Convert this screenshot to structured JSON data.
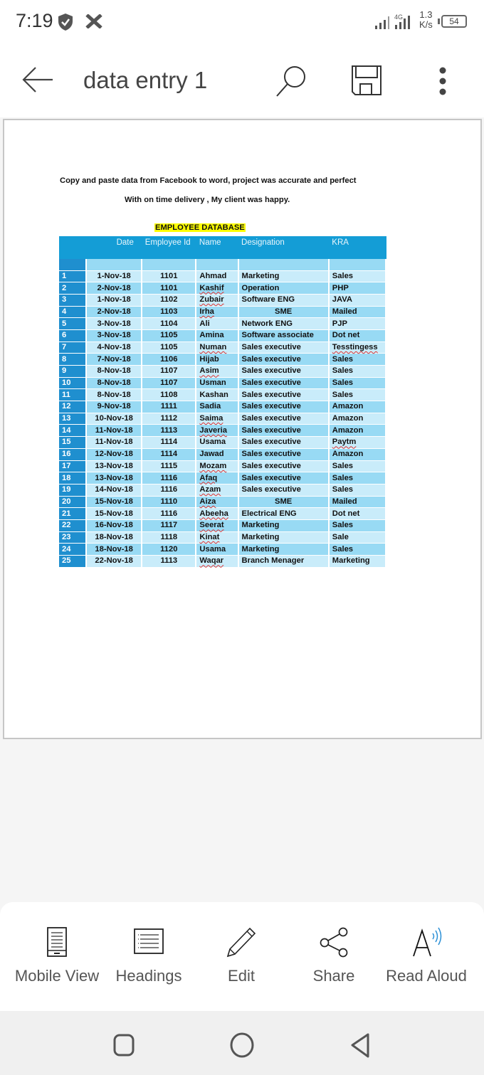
{
  "status_bar": {
    "time": "7:19",
    "network_type": "4G",
    "net_speed_value": "1.3",
    "net_speed_unit": "K/s",
    "battery": "54",
    "icons": [
      "shield-check-icon",
      "x-app-icon",
      "signal-icon",
      "signal-4g-icon",
      "battery-icon"
    ]
  },
  "toolbar": {
    "title": "data entry 1",
    "icons": [
      "back-arrow-icon",
      "search-icon",
      "save-icon",
      "more-vert-icon"
    ]
  },
  "document": {
    "line1": "Copy and paste data from Facebook to word, project was accurate and perfect",
    "line2": "With on time delivery , My client was happy.",
    "heading": "EMPLOYEE DATABASE",
    "heading_highlight": "#ffff00",
    "table": {
      "headers": [
        "",
        "Date",
        "Employee Id",
        "Name",
        "Designation",
        "KRA"
      ],
      "header_color": "#149dd6",
      "rows": [
        {
          "no": "1",
          "date": "1-Nov-18",
          "id": "1101",
          "name": "Ahmad",
          "designation": "Marketing",
          "kra": "Sales"
        },
        {
          "no": "2",
          "date": "2-Nov-18",
          "id": "1101",
          "name": "Kashif",
          "designation": "Operation",
          "kra": "PHP"
        },
        {
          "no": "3",
          "date": "1-Nov-18",
          "id": "1102",
          "name": "Zubair",
          "designation": "Software ENG",
          "kra": "JAVA"
        },
        {
          "no": "4",
          "date": "2-Nov-18",
          "id": "1103",
          "name": "Irha",
          "designation": "SME",
          "kra": "Mailed"
        },
        {
          "no": "5",
          "date": "3-Nov-18",
          "id": "1104",
          "name": "Ali",
          "designation": "Network ENG",
          "kra": "PJP"
        },
        {
          "no": "6",
          "date": "3-Nov-18",
          "id": "1105",
          "name": "Amina",
          "designation": "Software associate",
          "kra": "Dot net"
        },
        {
          "no": "7",
          "date": "4-Nov-18",
          "id": "1105",
          "name": "Numan",
          "designation": "Sales executive",
          "kra": "Tesstingess"
        },
        {
          "no": "8",
          "date": "7-Nov-18",
          "id": "1106",
          "name": "Hijab",
          "designation": "Sales executive",
          "kra": "Sales"
        },
        {
          "no": "9",
          "date": "8-Nov-18",
          "id": "1107",
          "name": "Asim",
          "designation": "Sales executive",
          "kra": "Sales"
        },
        {
          "no": "10",
          "date": "8-Nov-18",
          "id": "1107",
          "name": "Usman",
          "designation": "Sales executive",
          "kra": "Sales"
        },
        {
          "no": "11",
          "date": "8-Nov-18",
          "id": "1108",
          "name": "Kashan",
          "designation": "Sales executive",
          "kra": "Sales"
        },
        {
          "no": "12",
          "date": "9-Nov-18",
          "id": "1111",
          "name": "Sadia",
          "designation": "Sales executive",
          "kra": "Amazon"
        },
        {
          "no": "13",
          "date": "10-Nov-18",
          "id": "1112",
          "name": "Saima",
          "designation": "Sales executive",
          "kra": "Amazon"
        },
        {
          "no": "14",
          "date": "11-Nov-18",
          "id": "1113",
          "name": "Javeria",
          "designation": "Sales executive",
          "kra": "Amazon"
        },
        {
          "no": "15",
          "date": "11-Nov-18",
          "id": "1114",
          "name": "Usama",
          "designation": "Sales executive",
          "kra": "Paytm"
        },
        {
          "no": "16",
          "date": "12-Nov-18",
          "id": "1114",
          "name": "Jawad",
          "designation": "Sales executive",
          "kra": "Amazon"
        },
        {
          "no": "17",
          "date": "13-Nov-18",
          "id": "1115",
          "name": "Mozam",
          "designation": "Sales executive",
          "kra": "Sales"
        },
        {
          "no": "18",
          "date": "13-Nov-18",
          "id": "1116",
          "name": "Afaq",
          "designation": "Sales executive",
          "kra": "Sales"
        },
        {
          "no": "19",
          "date": "14-Nov-18",
          "id": "1116",
          "name": "Azam",
          "designation": "Sales executive",
          "kra": "Sales"
        },
        {
          "no": "20",
          "date": "15-Nov-18",
          "id": "1110",
          "name": "Aiza",
          "designation": "SME",
          "kra": "Mailed"
        },
        {
          "no": "21",
          "date": "15-Nov-18",
          "id": "1116",
          "name": "Abeeha",
          "designation": "Electrical ENG",
          "kra": "Dot net"
        },
        {
          "no": "22",
          "date": "16-Nov-18",
          "id": "1117",
          "name": "Seerat",
          "designation": "Marketing",
          "kra": "Sales"
        },
        {
          "no": "23",
          "date": "18-Nov-18",
          "id": "1118",
          "name": "Kinat",
          "designation": "Marketing",
          "kra": "Sale"
        },
        {
          "no": "24",
          "date": "18-Nov-18",
          "id": "1120",
          "name": "Usama",
          "designation": "Marketing",
          "kra": "Sales"
        },
        {
          "no": "25",
          "date": "22-Nov-18",
          "id": "1113",
          "name": "Waqar",
          "designation": "Branch Menager",
          "kra": "Marketing"
        }
      ]
    }
  },
  "bottom_actions": [
    {
      "label": "Mobile View",
      "icon": "mobile-view-icon"
    },
    {
      "label": "Headings",
      "icon": "headings-icon"
    },
    {
      "label": "Edit",
      "icon": "pencil-icon"
    },
    {
      "label": "Share",
      "icon": "share-icon"
    },
    {
      "label": "Read Aloud",
      "icon": "read-aloud-icon"
    }
  ],
  "nav_bar": {
    "buttons": [
      "recents-icon",
      "home-icon",
      "back-icon"
    ]
  },
  "colors": {
    "accent_read_aloud": "#2a8fd6",
    "row_dark": "#98daf4",
    "row_light": "#c9ecfa",
    "number_col": "#1f8fcf"
  }
}
